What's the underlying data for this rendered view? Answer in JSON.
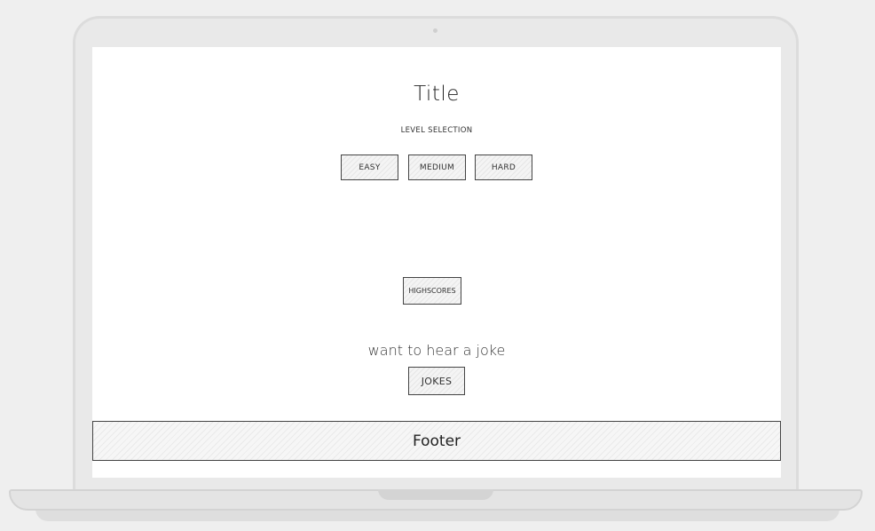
{
  "main": {
    "title": "Title",
    "level_selection_label": "LEVEL SELECTION",
    "levels": {
      "easy": "EASY",
      "medium": "MEDIUM",
      "hard": "HARD"
    },
    "highscores_label": "HIGHSCORES",
    "joke_prompt": "want to hear a joke",
    "jokes_label": "JOKES"
  },
  "footer": {
    "label": "Footer"
  },
  "colors": {
    "background": "#efefef",
    "device": "#e9e9e9",
    "screen": "#ffffff",
    "sketch_line": "#444444"
  }
}
